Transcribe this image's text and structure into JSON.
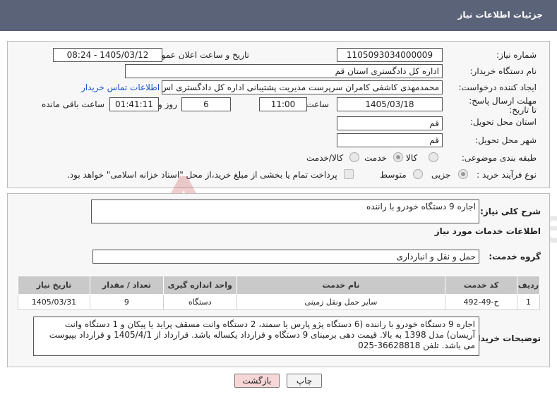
{
  "header": {
    "title": "جزئیات اطلاعات نیاز"
  },
  "form": {
    "need_number_label": "شماره نیاز:",
    "need_number": "1105093034000009",
    "announce_label": "تاریخ و ساعت اعلان عمومی:",
    "announce_value": "1405/03/12 - 08:24",
    "buyer_label": "نام دستگاه خریدار:",
    "buyer_value": "اداره کل دادگستری استان قم",
    "requester_label": "ایجاد کننده درخواست:",
    "requester_value": "محمدمهدی کاشفی کامران سرپرست مدیریت پشتیبانی اداره کل دادگستری اس",
    "contact_link": "اطلاعات تماس خریدار",
    "deadline_label": "مهلت ارسال پاسخ: تا تاریخ:",
    "deadline_date": "1405/03/18",
    "time_label": "ساعت",
    "deadline_time": "11:00",
    "days_value": "6",
    "days_label": "روز و",
    "remaining_time": "01:41:11",
    "remaining_label": "ساعت باقی مانده",
    "province_label": "استان محل تحویل:",
    "province_value": "قم",
    "city_label": "شهر محل تحویل:",
    "city_value": "قم",
    "category_label": "طبقه بندی موضوعی:",
    "category_options": [
      "کالا",
      "خدمت",
      "کالا/خدمت"
    ],
    "category_selected": "خدمت",
    "process_label": "نوع فرآیند خرید :",
    "process_options": [
      "جزیی",
      "متوسط"
    ],
    "payment_note": "پرداخت تمام یا بخشی از مبلغ خرید،از محل \"اسناد خزانه اسلامی\" خواهد بود."
  },
  "details": {
    "summary_label": "شرح کلی نیاز:",
    "summary_value": "اجاره 9 دستگاه خودرو با راننده",
    "services_heading": "اطلاعات خدمات مورد نیاز",
    "service_group_label": "گروه خدمت:",
    "service_group_value": "حمل و نقل و انبارداری",
    "table": {
      "headers": [
        "ردیف",
        "کد خدمت",
        "نام خدمت",
        "واحد اندازه گیری",
        "تعداد / مقدار",
        "تاریخ نیاز"
      ],
      "rows": [
        [
          "1",
          "ح-49-492",
          "سایر حمل ونقل زمینی",
          "دستگاه",
          "9",
          "1405/03/31"
        ]
      ]
    },
    "buyer_notes_label": "توضیحات خریدار:",
    "buyer_notes": "اجاره 9 دستگاه خودرو با راننده (6 دستگاه پژو پارس یا سمند، 2 دستگاه وانت مسقف پراید یا پیکان و 1 دستگاه وانت آریسان) مدل 1398 به بالا. قیمت دهی برمبنای 9 دستگاه و قرارداد یکساله باشد. قرارداد از 1405/4/1 و قرارداد بپیوست می باشد. تلفن 36628818-025"
  },
  "buttons": {
    "print": "چاپ",
    "back": "بازگشت"
  },
  "watermark": {
    "text": "AriaTender.net"
  },
  "colors": {
    "header_bg": "#5a6378",
    "link": "#1a56c7",
    "back_button_bg": "#f6d6d6"
  }
}
